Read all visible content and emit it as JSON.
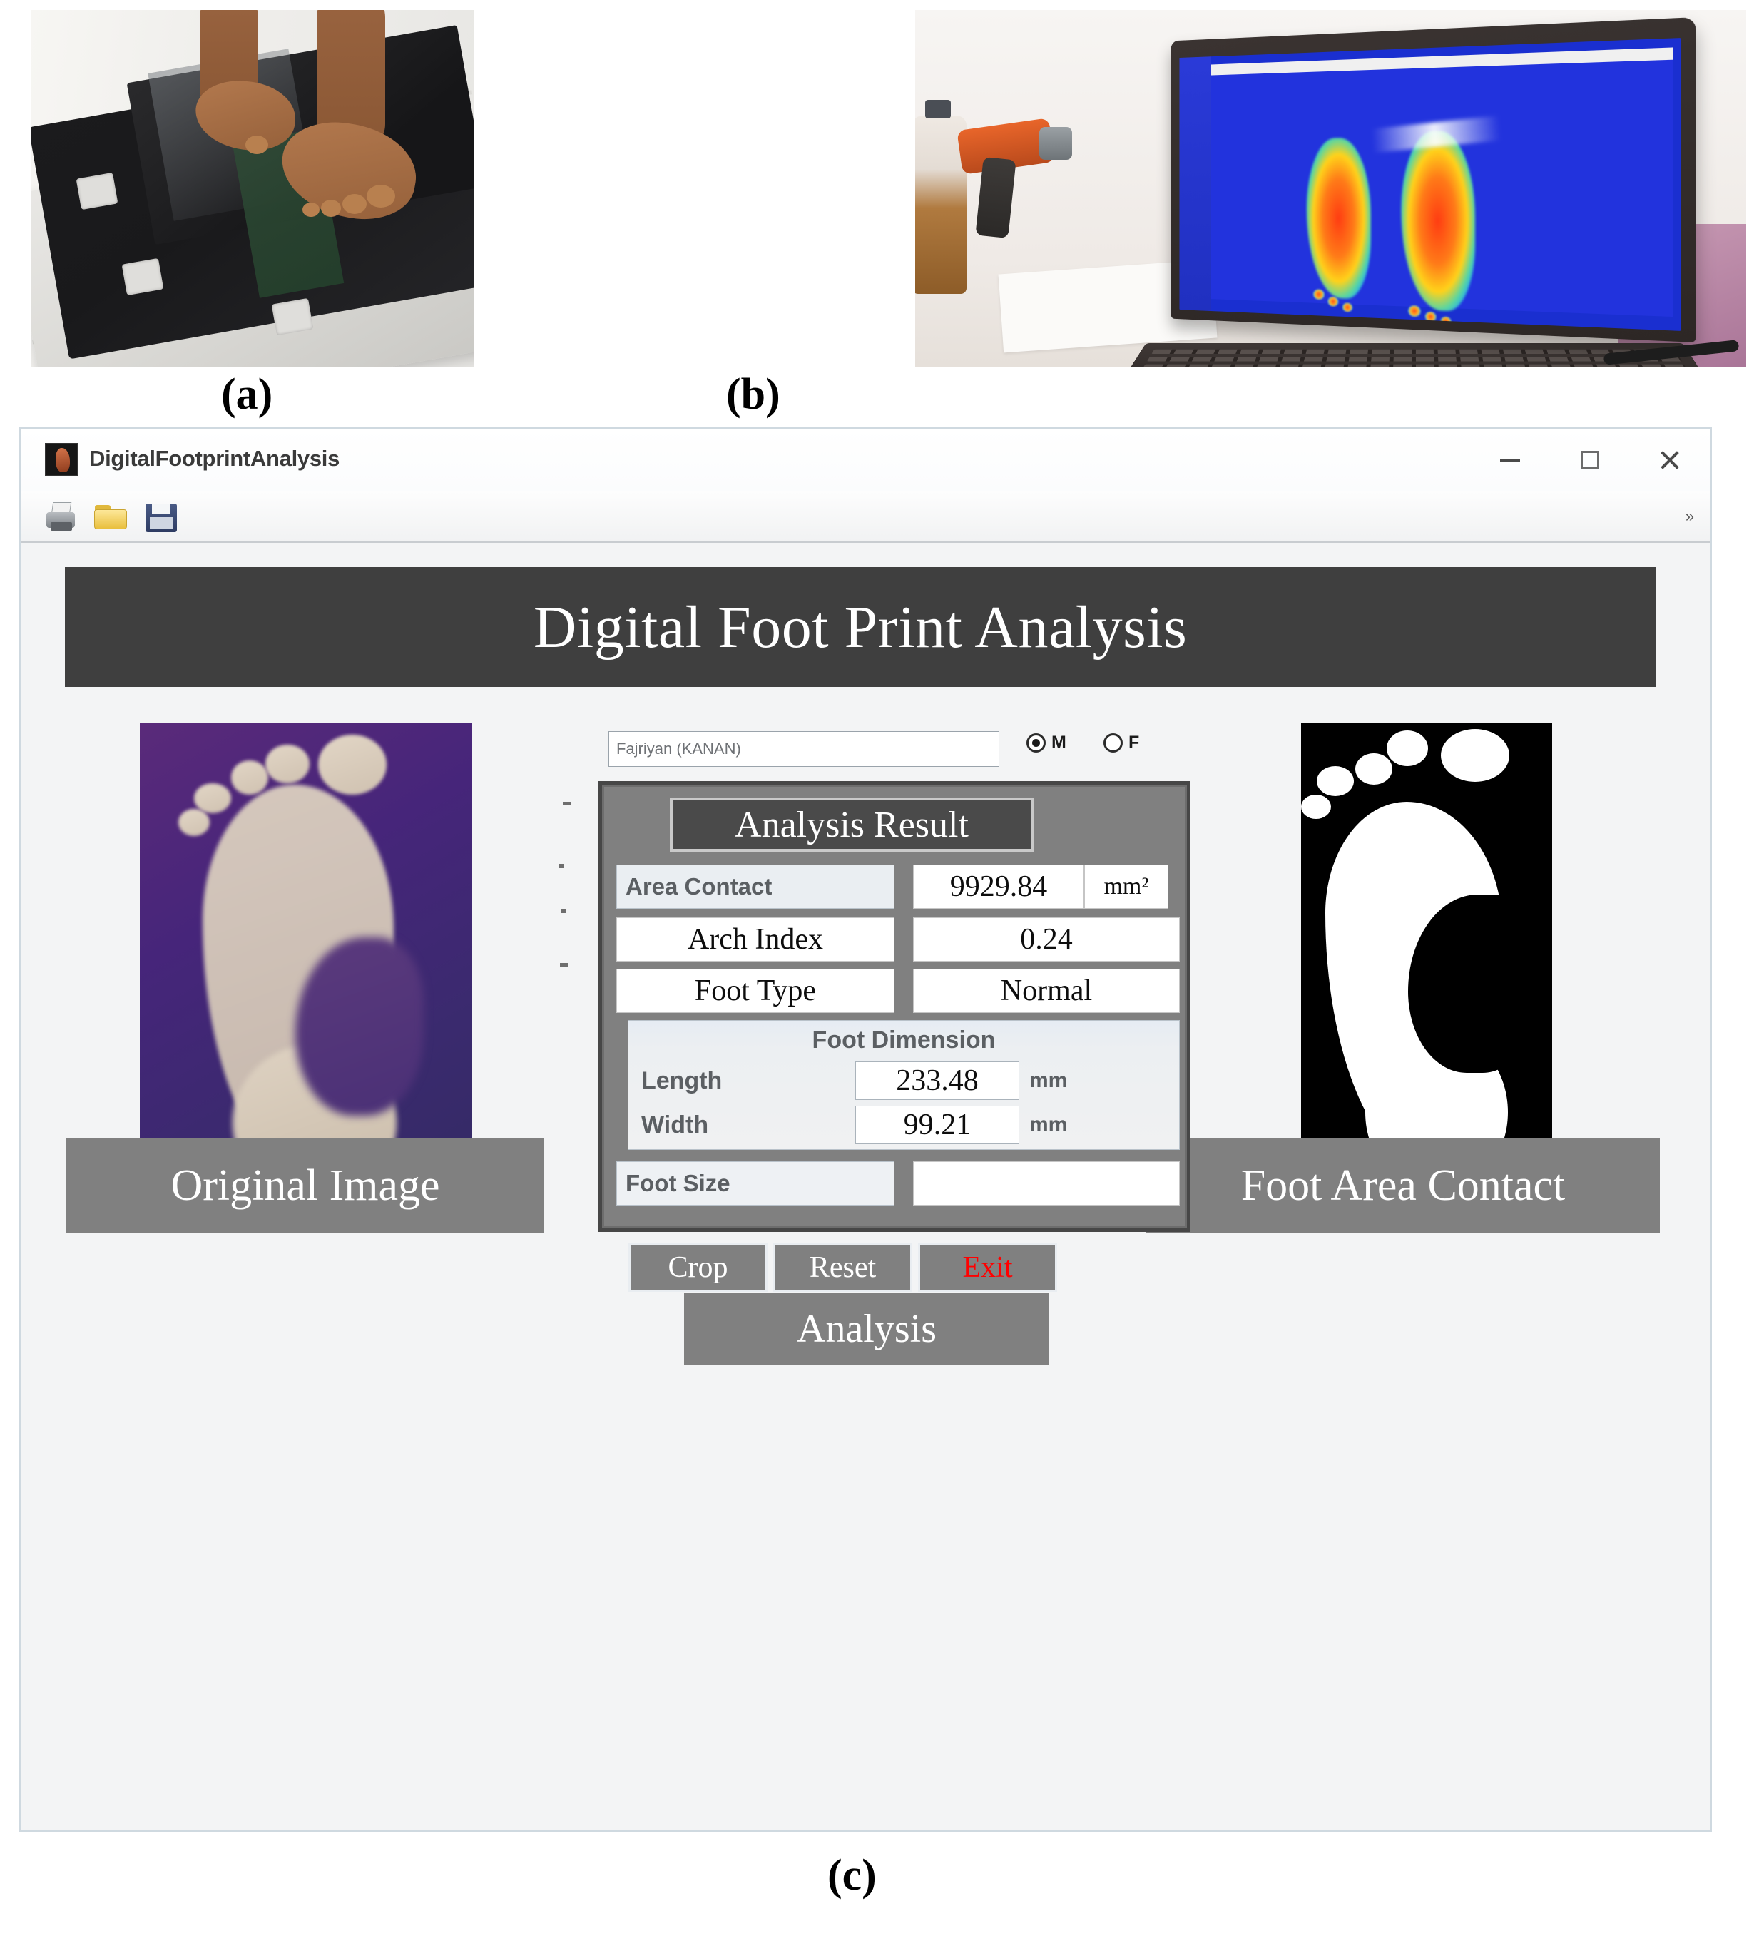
{
  "figure": {
    "caption_a": "(a)",
    "caption_b": "(b)",
    "caption_c": "(c)",
    "panel_a_description": "Subject standing barefoot on the digital footprint scanner glass platform on a white tiled floor",
    "panel_b_description": "Laptop screen displaying the pressure heat map of both feet with blue background and red-orange contours"
  },
  "window": {
    "title": "DigitalFootprintAnalysis",
    "icon": "app-footprint-icon",
    "controls": {
      "minimize": "minimize-icon",
      "maximize": "maximize-icon",
      "close": "close-icon"
    },
    "toolbar": {
      "print": "print-icon",
      "open": "open-folder-icon",
      "save": "save-disk-icon",
      "overflow": "toolbar-overflow-chevron"
    }
  },
  "banner": {
    "title": "Digital Foot Print Analysis"
  },
  "subject": {
    "name_value": "Fajriyan (KANAN)",
    "name_placeholder": "Fajriyan (KANAN)",
    "gender": {
      "male_label": "M",
      "female_label": "F",
      "selected": "M"
    }
  },
  "images": {
    "left_label": "Original Image",
    "right_label": "Foot Area Contact"
  },
  "results": {
    "panel_title": "Analysis Result",
    "rows": [
      {
        "label": "Area Contact",
        "value": "9929.84",
        "unit": "mm²"
      },
      {
        "label": "Arch Index",
        "value": "0.24",
        "unit": ""
      },
      {
        "label": "Foot Type",
        "value": "Normal",
        "unit": ""
      }
    ],
    "dimension": {
      "title": "Foot Dimension",
      "length_label": "Length",
      "length_value": "233.48",
      "length_unit": "mm",
      "width_label": "Width",
      "width_value": "99.21",
      "width_unit": "mm"
    },
    "foot_size": {
      "label": "Foot Size",
      "value": ""
    }
  },
  "actions": {
    "crop": "Crop",
    "reset": "Reset",
    "exit": "Exit",
    "analysis": "Analysis"
  },
  "colors": {
    "banner_bg": "#3f3f3f",
    "panel_bg": "#808080",
    "label_bg": "#808080",
    "exit_text": "#ff0000",
    "button_bg": "#808080",
    "window_body": "#f3f4f5"
  }
}
